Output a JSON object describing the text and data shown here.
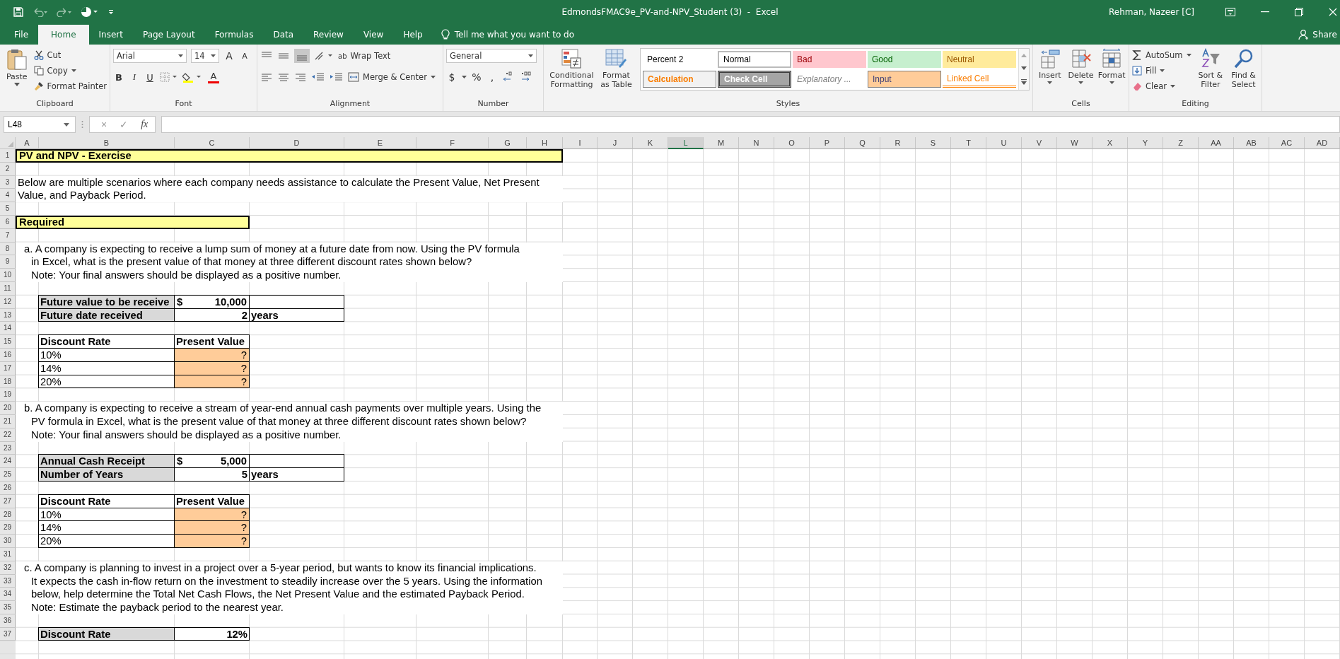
{
  "title_bar": {
    "title": "EdmondsFMAC9e_PV-and-NPV_Student (3)  -  Excel",
    "user": "Rehman, Nazeer [C]"
  },
  "tabs": [
    {
      "label": "File",
      "selected": false
    },
    {
      "label": "Home",
      "selected": true
    },
    {
      "label": "Insert",
      "selected": false
    },
    {
      "label": "Page Layout",
      "selected": false
    },
    {
      "label": "Formulas",
      "selected": false
    },
    {
      "label": "Data",
      "selected": false
    },
    {
      "label": "Review",
      "selected": false
    },
    {
      "label": "View",
      "selected": false
    },
    {
      "label": "Help",
      "selected": false
    }
  ],
  "tell_me": "Tell me what you want to do",
  "share": "Share",
  "ribbon": {
    "clipboard": {
      "label": "Clipboard",
      "paste": "Paste",
      "cut": "Cut",
      "copy": "Copy",
      "format_painter": "Format Painter"
    },
    "font": {
      "label": "Font",
      "font_name": "Arial",
      "font_size": "14",
      "grow": "A",
      "shrink": "A",
      "bold": "B",
      "italic": "I",
      "underline": "U",
      "font_color": "A"
    },
    "alignment": {
      "label": "Alignment",
      "wrap_glyph": "ab",
      "wrap_text": "Wrap Text",
      "merge_center": "Merge & Center"
    },
    "number": {
      "label": "Number",
      "format": "General",
      "currency": "$",
      "percent": "%",
      "comma": ","
    },
    "styles": {
      "label": "Styles",
      "conditional": "Conditional Formatting",
      "format_table": "Format as Table",
      "gallery": [
        {
          "label": "Percent 2",
          "kind": "plain"
        },
        {
          "label": "Normal",
          "kind": "normal"
        },
        {
          "label": "Bad",
          "kind": "bad"
        },
        {
          "label": "Good",
          "kind": "good"
        },
        {
          "label": "Neutral",
          "kind": "neutral"
        },
        {
          "label": "Calculation",
          "kind": "calculation"
        },
        {
          "label": "Check Cell",
          "kind": "check"
        },
        {
          "label": "Explanatory ...",
          "kind": "explanatory"
        },
        {
          "label": "Input",
          "kind": "input"
        },
        {
          "label": "Linked Cell",
          "kind": "linked"
        }
      ]
    },
    "cells": {
      "label": "Cells",
      "insert": "Insert",
      "delete": "Delete",
      "format": "Format"
    },
    "editing": {
      "label": "Editing",
      "autosum": "AutoSum",
      "fill": "Fill",
      "clear": "Clear",
      "sort": "Sort & Filter",
      "find": "Find & Select"
    }
  },
  "formula_bar": {
    "name_box": "L48",
    "cancel": "×",
    "enter": "✓",
    "fx": "fx"
  },
  "sheet": {
    "columns": [
      {
        "label": "A",
        "selected": false
      },
      {
        "label": "B",
        "selected": false
      },
      {
        "label": "C",
        "selected": false
      },
      {
        "label": "D",
        "selected": false
      },
      {
        "label": "E",
        "selected": false
      },
      {
        "label": "F",
        "selected": false
      },
      {
        "label": "G",
        "selected": false
      },
      {
        "label": "H",
        "selected": false
      },
      {
        "label": "I",
        "selected": false
      },
      {
        "label": "J",
        "selected": false
      },
      {
        "label": "K",
        "selected": false
      },
      {
        "label": "L",
        "selected": true
      },
      {
        "label": "M",
        "selected": false
      },
      {
        "label": "N",
        "selected": false
      },
      {
        "label": "O",
        "selected": false
      },
      {
        "label": "P",
        "selected": false
      },
      {
        "label": "Q",
        "selected": false
      },
      {
        "label": "R",
        "selected": false
      },
      {
        "label": "S",
        "selected": false
      },
      {
        "label": "T",
        "selected": false
      },
      {
        "label": "U",
        "selected": false
      },
      {
        "label": "V",
        "selected": false
      },
      {
        "label": "W",
        "selected": false
      },
      {
        "label": "X",
        "selected": false
      },
      {
        "label": "Y",
        "selected": false
      },
      {
        "label": "Z",
        "selected": false
      },
      {
        "label": "AA",
        "selected": false
      },
      {
        "label": "AB",
        "selected": false
      },
      {
        "label": "AC",
        "selected": false
      },
      {
        "label": "AD",
        "selected": false
      }
    ],
    "rows": [
      {
        "label": "1",
        "kind": "title",
        "text": "PV and NPV - Exercise"
      },
      {
        "label": "2"
      },
      {
        "label": "3",
        "kind": "text",
        "text": "Below are multiple scenarios where each company needs assistance to calculate the Present Value, Net Present"
      },
      {
        "label": "4",
        "kind": "text",
        "text": "Value, and Payback Period."
      },
      {
        "label": "5"
      },
      {
        "label": "6",
        "kind": "section",
        "text": "Required"
      },
      {
        "label": "7"
      },
      {
        "label": "8",
        "kind": "item",
        "text": "a. A company is expecting to receive a lump sum of money at a future date from now.  Using the PV formula"
      },
      {
        "label": "9",
        "kind": "item_cont",
        "text": "in Excel, what is the present value of that money at three different discount rates shown below?"
      },
      {
        "label": "10",
        "kind": "item_cont",
        "text": "Note: Your final answers should be displayed as a positive number."
      },
      {
        "label": "11"
      },
      {
        "label": "12",
        "cells": [
          "",
          {
            "kind": "label",
            "text": "Future value to be receive"
          },
          {
            "kind": "amount",
            "currency": "$",
            "text": "10,000"
          },
          {
            "kind": "blank"
          }
        ]
      },
      {
        "label": "13",
        "cells": [
          "",
          {
            "kind": "label",
            "text": "Future date received"
          },
          {
            "kind": "number",
            "text": "2"
          },
          {
            "kind": "unit",
            "text": "years"
          }
        ]
      },
      {
        "label": "14"
      },
      {
        "label": "15",
        "cells": [
          "",
          {
            "kind": "header",
            "text": "Discount Rate"
          },
          {
            "kind": "header",
            "text": "Present Value"
          }
        ]
      },
      {
        "label": "16",
        "cells": [
          "",
          {
            "kind": "rate",
            "text": "10%"
          },
          {
            "kind": "answer",
            "text": "?"
          }
        ]
      },
      {
        "label": "17",
        "cells": [
          "",
          {
            "kind": "rate",
            "text": "14%"
          },
          {
            "kind": "answer",
            "text": "?"
          }
        ]
      },
      {
        "label": "18",
        "cells": [
          "",
          {
            "kind": "rate",
            "text": "20%"
          },
          {
            "kind": "answer",
            "text": "?"
          }
        ]
      },
      {
        "label": "19"
      },
      {
        "label": "20",
        "kind": "item",
        "text": "b. A company is expecting to receive a stream of year-end annual cash payments over multiple years.  Using the"
      },
      {
        "label": "21",
        "kind": "item_cont",
        "text": "PV formula in Excel, what is the present value of that money at three different discount rates shown below?"
      },
      {
        "label": "22",
        "kind": "item_cont",
        "text": "Note: Your final answers should be displayed as a positive number."
      },
      {
        "label": "23"
      },
      {
        "label": "24",
        "cells": [
          "",
          {
            "kind": "label",
            "text": "Annual Cash Receipt"
          },
          {
            "kind": "amount",
            "currency": "$",
            "text": "5,000"
          },
          {
            "kind": "blank"
          }
        ]
      },
      {
        "label": "25",
        "cells": [
          "",
          {
            "kind": "label",
            "text": "Number of Years"
          },
          {
            "kind": "number",
            "text": "5"
          },
          {
            "kind": "unit",
            "text": "years"
          }
        ]
      },
      {
        "label": "26"
      },
      {
        "label": "27",
        "cells": [
          "",
          {
            "kind": "header",
            "text": "Discount Rate"
          },
          {
            "kind": "header",
            "text": "Present Value"
          }
        ]
      },
      {
        "label": "28",
        "cells": [
          "",
          {
            "kind": "rate",
            "text": "10%"
          },
          {
            "kind": "answer",
            "text": "?"
          }
        ]
      },
      {
        "label": "29",
        "cells": [
          "",
          {
            "kind": "rate",
            "text": "14%"
          },
          {
            "kind": "answer",
            "text": "?"
          }
        ]
      },
      {
        "label": "30",
        "cells": [
          "",
          {
            "kind": "rate",
            "text": "20%"
          },
          {
            "kind": "answer",
            "text": "?"
          }
        ]
      },
      {
        "label": "31"
      },
      {
        "label": "32",
        "kind": "item",
        "text": "c. A company is planning to invest in a project over a 5-year period, but wants to know its financial implications."
      },
      {
        "label": "33",
        "kind": "item_cont",
        "text": "It expects the cash in-flow return on the investment to steadily increase over the 5 years.  Using the information"
      },
      {
        "label": "34",
        "kind": "item_cont",
        "text": "below, help determine the Total Net Cash Flows, the Net Present Value and the estimated Payback Period."
      },
      {
        "label": "35",
        "kind": "item_cont",
        "text": "Note:  Estimate the payback period to the nearest year."
      },
      {
        "label": "36"
      },
      {
        "label": "37",
        "cells": [
          "",
          {
            "kind": "label",
            "text": "Discount Rate"
          },
          {
            "kind": "number",
            "text": "12%"
          }
        ]
      }
    ]
  }
}
